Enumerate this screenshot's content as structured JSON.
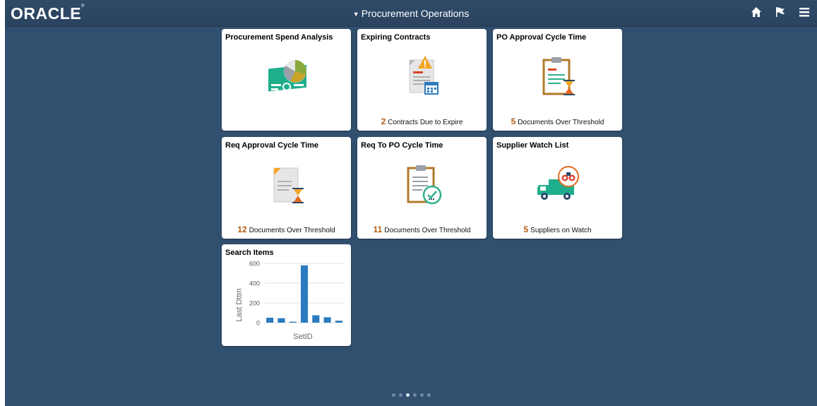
{
  "header": {
    "logo": "ORACLE",
    "title": "Procurement Operations"
  },
  "nav_icons": [
    "home-icon",
    "flag-icon",
    "menu-icon"
  ],
  "tiles": [
    {
      "title": "Procurement Spend Analysis",
      "count": "",
      "footer": "",
      "icon": "spend-chart-icon"
    },
    {
      "title": "Expiring Contracts",
      "count": "2",
      "footer": "Contracts Due to Expire",
      "icon": "contract-warning-icon"
    },
    {
      "title": "PO Approval Cycle Time",
      "count": "5",
      "footer": "Documents Over Threshold",
      "icon": "clipboard-hourglass-icon"
    },
    {
      "title": "Req Approval Cycle Time",
      "count": "12",
      "footer": "Documents Over Threshold",
      "icon": "document-hourglass-icon"
    },
    {
      "title": "Req To PO Cycle Time",
      "count": "11",
      "footer": "Documents Over Threshold",
      "icon": "clipboard-check-icon"
    },
    {
      "title": "Supplier Watch List",
      "count": "5",
      "footer": "Suppliers on Watch",
      "icon": "truck-binoculars-icon"
    },
    {
      "title": "Search Items",
      "count": "",
      "footer": "",
      "icon": ""
    }
  ],
  "chart_data": {
    "type": "bar",
    "title": "Search Items",
    "xlabel": "SetID",
    "ylabel": "Last Dttm",
    "ylim": [
      0,
      600
    ],
    "yticks": [
      0,
      200,
      400,
      600
    ],
    "categories": [
      "",
      "",
      "",
      "",
      "",
      "",
      ""
    ],
    "values": [
      50,
      45,
      10,
      580,
      75,
      55,
      20
    ],
    "grid": true,
    "color": "#2a7bbf"
  },
  "pager": {
    "count": 6,
    "active": 2
  },
  "colors": {
    "background": "#31506f",
    "accent_number": "#b15b12",
    "bar": "#2a7bbf"
  }
}
